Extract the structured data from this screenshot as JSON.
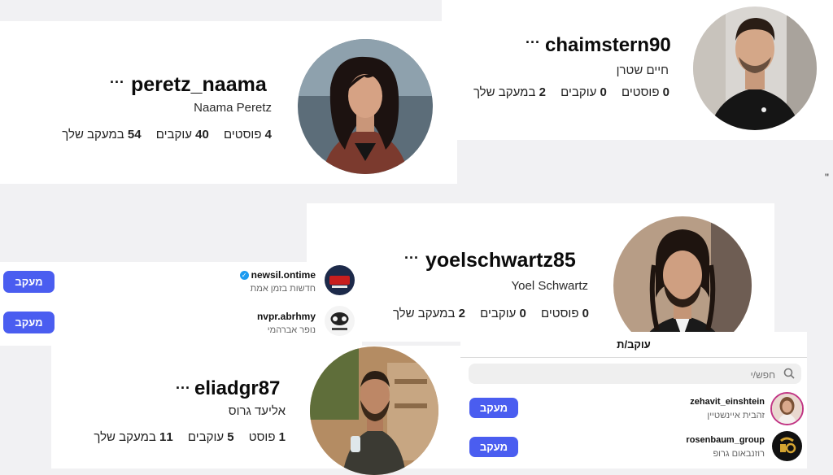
{
  "cards": {
    "peretz": {
      "username": "peretz_naama",
      "fullname": "Naama Peretz",
      "posts": "4",
      "posts_label": "פוסטים",
      "followers": "40",
      "followers_label": "עוקבים",
      "following": "54",
      "following_label": "במעקב שלך"
    },
    "chaim": {
      "username": "chaimstern90",
      "fullname": "חיים שטרן",
      "posts": "0",
      "posts_label": "פוסטים",
      "followers": "0",
      "followers_label": "עוקבים",
      "following": "2",
      "following_label": "במעקב שלך"
    },
    "yoel": {
      "username": "yoelschwartz85",
      "fullname": "Yoel Schwartz",
      "posts": "0",
      "posts_label": "פוסטים",
      "followers": "0",
      "followers_label": "עוקבים",
      "following": "2",
      "following_label": "במעקב שלך"
    },
    "eliad": {
      "username": "eliadgr87",
      "fullname": "אליעד גרוס",
      "posts": "1",
      "posts_label": "פוסט",
      "followers": "5",
      "followers_label": "עוקבים",
      "following": "11",
      "following_label": "במעקב שלך"
    },
    "more_symbol": "..."
  },
  "follow_list_left": {
    "items": [
      {
        "username": "newsil.ontime",
        "subtitle": "חדשות בזמן אמת",
        "verified": true,
        "button": "מעקב"
      },
      {
        "username": "nvpr.abrhmy",
        "subtitle": "נופר אברהמי",
        "verified": false,
        "button": "מעקב"
      }
    ]
  },
  "followers_panel": {
    "title": "עוקב/ת",
    "search_placeholder": "חפש/י",
    "items": [
      {
        "username": "zehavit_einshtein",
        "subtitle": "זהבית איינשטיין",
        "button": "מעקב"
      },
      {
        "username": "rosenbaum_group",
        "subtitle": "רוזנבאום גרופ",
        "button": "מעקב"
      }
    ]
  },
  "stray_glyph": "\"",
  "colors": {
    "accent": "#4a5df0",
    "verified": "#1d9bf0"
  }
}
